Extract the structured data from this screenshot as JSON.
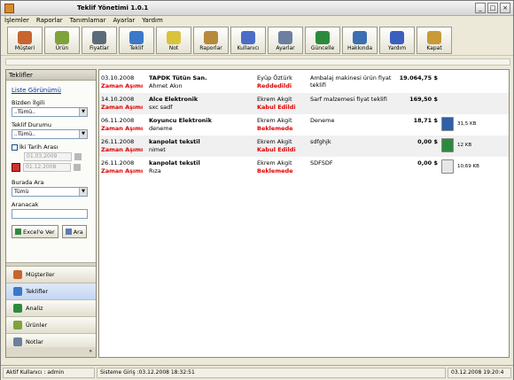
{
  "window": {
    "title": "Teklif Yönetimi 1.0.1"
  },
  "menu": [
    "İşlemler",
    "Raporlar",
    "Tanımlamar",
    "Ayarlar",
    "Yardım"
  ],
  "toolbar": [
    {
      "label": "Müşteri",
      "icon": "users-icon",
      "color": "#c8652e"
    },
    {
      "label": "Ürün",
      "icon": "box-icon",
      "color": "#7fa23b"
    },
    {
      "label": "Fiyatlar",
      "icon": "calculator-icon",
      "color": "#5c6b78"
    },
    {
      "label": "Teklif",
      "icon": "document-icon",
      "color": "#3b78c8"
    },
    {
      "label": "Not",
      "icon": "note-icon",
      "color": "#d9c33a"
    },
    {
      "label": "Raporlar",
      "icon": "clipboard-icon",
      "color": "#b7893b"
    },
    {
      "label": "Kullanıcı",
      "icon": "user-check-icon",
      "color": "#4a6dc8"
    },
    {
      "label": "Ayarlar",
      "icon": "gear-icon",
      "color": "#6d7fa0"
    },
    {
      "label": "Güncelle",
      "icon": "globe-icon",
      "color": "#2d8a3c"
    },
    {
      "label": "Hakkında",
      "icon": "info-icon",
      "color": "#3c6fb0"
    },
    {
      "label": "Yardım",
      "icon": "help-icon",
      "color": "#3a5fbf"
    },
    {
      "label": "Kapat",
      "icon": "exit-icon",
      "color": "#c89a38"
    }
  ],
  "left_panel": {
    "header": "Teklifler",
    "list_view_link": "Liste Görünümü",
    "related_label": "Bizden İlgili",
    "related_value": "..Tümü..",
    "status_label": "Teklif Durumu",
    "status_value": "..Tümü..",
    "date_range_label": "İki Tarih Arası",
    "date_from": "01.03.2009",
    "date_to": "01.12.2008",
    "search_in_label": "Burada Ara",
    "search_in_value": "Tümü",
    "search_label": "Aranacak",
    "excel_button": "Excel'e Ver",
    "search_button": "Ara"
  },
  "nav": [
    {
      "label": "Müşteriler",
      "icon": "users-icon",
      "color": "#c8652e"
    },
    {
      "label": "Teklifler",
      "icon": "document-icon",
      "color": "#3b78c8"
    },
    {
      "label": "Analiz",
      "icon": "chart-icon",
      "color": "#2d8a3c"
    },
    {
      "label": "Ürünler",
      "icon": "box-icon",
      "color": "#7fa23b"
    },
    {
      "label": "Notlar",
      "icon": "note-icon",
      "color": "#6d7fa0"
    }
  ],
  "offers": [
    {
      "date": "03.10.2008",
      "timeout": "Zaman Aşımı",
      "company": "TAPDK Tütün San.",
      "contact": "Ahmet Akın",
      "user": "Eyüp Öztürk",
      "status": "Reddedildi",
      "desc": "Ambalaj makinesi ürün fiyat teklifi",
      "amount": "19.064,75 $",
      "file": null,
      "size": null
    },
    {
      "date": "14.10.2008",
      "timeout": "Zaman Aşımı",
      "company": "Alce Elektronik",
      "contact": "sxc sadf",
      "user": "Ekrem Akgit",
      "status": "Kabul Edildi",
      "desc": "Sarf malzemesi fiyat teklifi",
      "amount": "169,50 $",
      "file": null,
      "size": null
    },
    {
      "date": "06.11.2008",
      "timeout": "Zaman Aşımı",
      "company": "Koyuncu Elektronik",
      "contact": "deneme",
      "user": "Ekrem Akgit",
      "status": "Beklemede",
      "desc": "Deneme",
      "amount": "18,71 $",
      "file": "word",
      "size": "31,5 KB"
    },
    {
      "date": "26.11.2008",
      "timeout": "Zaman Aşımı",
      "company": "kanpolat tekstil",
      "contact": "nimet",
      "user": "Ekrem Akgit",
      "status": "Kabul Edildi",
      "desc": "sdfghjk",
      "amount": "0,00 $",
      "file": "excel",
      "size": "12 KB"
    },
    {
      "date": "26.11.2008",
      "timeout": "Zaman Aşımı",
      "company": "kanpolat tekstil",
      "contact": "Rıza",
      "user": "Ekrem Akgit",
      "status": "Beklemede",
      "desc": "SDFSDF",
      "amount": "0,00 $",
      "file": "generic",
      "size": "10,69 KB"
    }
  ],
  "statusbar": {
    "user": "Aktif Kullanıcı : admin",
    "login": "Sisteme Giriş :03.12.2008 18:32:51",
    "now": "03.12.2008 19:20:4"
  }
}
